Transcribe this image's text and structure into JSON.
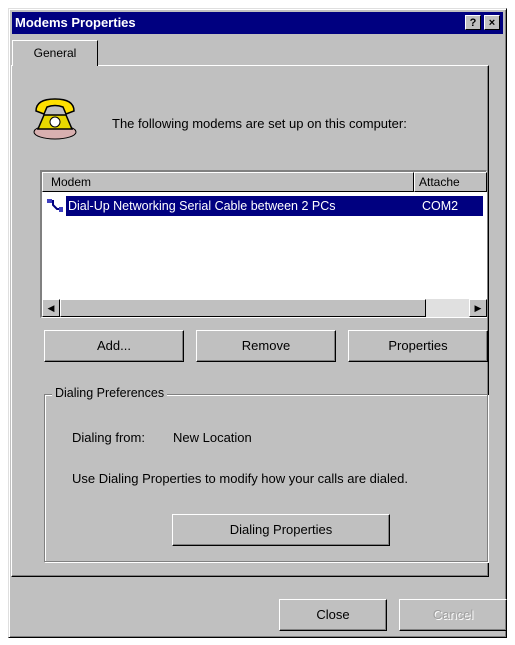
{
  "window": {
    "title": "Modems Properties",
    "help_glyph": "?",
    "close_glyph": "×"
  },
  "tabs": [
    {
      "label": "General"
    }
  ],
  "intro_text": "The following modems are set up on this computer:",
  "modem_list": {
    "columns": [
      "Modem",
      "Attache"
    ],
    "rows": [
      {
        "name": "Dial-Up Networking Serial Cable between 2 PCs",
        "attached_to": "COM2",
        "selected": true
      }
    ],
    "scroll_left": "◀",
    "scroll_right": "▶"
  },
  "buttons": {
    "add": "Add...",
    "remove": "Remove",
    "properties": "Properties"
  },
  "dialing_preferences": {
    "group_label": "Dialing Preferences",
    "from_label": "Dialing from:",
    "from_value": "New Location",
    "hint": "Use Dialing Properties to modify how your calls are dialed.",
    "dialing_properties_button": "Dialing Properties"
  },
  "footer": {
    "close": "Close",
    "cancel": "Cancel"
  },
  "colors": {
    "titlebar": "#000080",
    "face": "#c0c0c0",
    "selection": "#000080"
  }
}
